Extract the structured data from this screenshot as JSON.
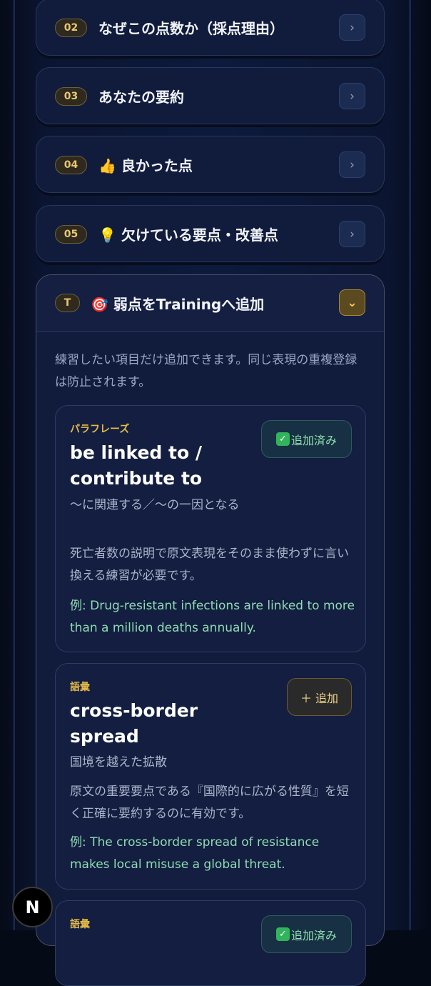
{
  "sections": [
    {
      "num": "02",
      "title": "なぜこの点数か（採点理由）"
    },
    {
      "num": "03",
      "title": "あなたの要約"
    },
    {
      "num": "04",
      "title": "👍 良かった点"
    },
    {
      "num": "05",
      "title": "💡 欠けている要点・改善点"
    }
  ],
  "training": {
    "num": "T",
    "title": "🎯 弱点をTrainingへ追加",
    "intro": "練習したい項目だけ追加できます。同じ表現の重複登録は防止されます。",
    "cards": [
      {
        "kind": "パラフレーズ",
        "phrase": "be linked to / contribute to",
        "meaning": "〜に関連する／〜の一因となる",
        "reason": "死亡者数の説明で原文表現をそのまま使わずに言い換える練習が必要です。",
        "example": "例: Drug-resistant infections are linked to more than a million deaths annually.",
        "button": "追加済み",
        "added": true
      },
      {
        "kind": "語彙",
        "phrase": "cross-border spread",
        "meaning": "国境を越えた拡散",
        "reason": "原文の重要要点である『国際的に広がる性質』を短く正確に要約するのに有効です。",
        "example": "例: The cross-border spread of resistance makes local misuse a global threat.",
        "button": "＋ 追加",
        "added": false
      },
      {
        "kind": "語彙",
        "button": "追加済み",
        "added": true
      }
    ]
  },
  "chevron_collapsed": "›",
  "chevron_expanded": "⌄",
  "dev_badge": "N",
  "colors": {
    "accent_gold": "#e4b948",
    "example_green": "#8fdcb3",
    "panel_bg": "#111c3d"
  }
}
